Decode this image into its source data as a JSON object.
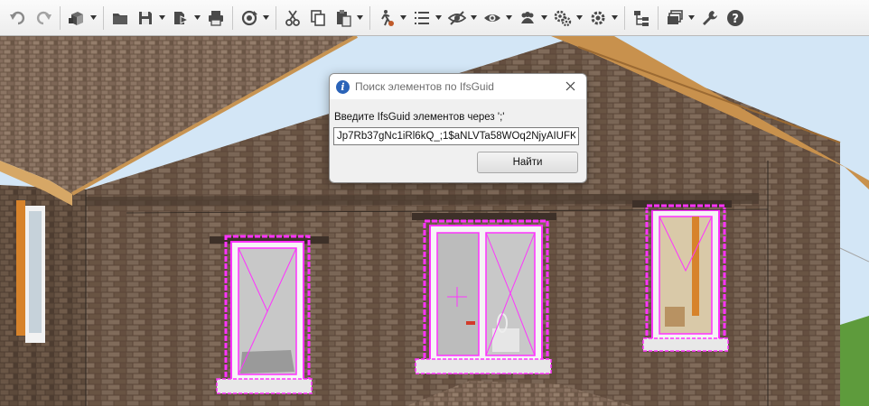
{
  "toolbar": {
    "buttons": [
      {
        "icon": "undo-icon",
        "dropdown": false
      },
      {
        "icon": "redo-icon",
        "dropdown": false
      },
      {
        "icon": "model-3d-icon",
        "dropdown": true
      },
      {
        "icon": "open-folder-icon",
        "dropdown": false
      },
      {
        "icon": "save-icon",
        "dropdown": true
      },
      {
        "icon": "export-icon",
        "dropdown": true
      },
      {
        "icon": "print-icon",
        "dropdown": false
      },
      {
        "icon": "orbit-icon",
        "dropdown": true
      },
      {
        "icon": "cut-icon",
        "dropdown": false
      },
      {
        "icon": "copy-icon",
        "dropdown": false
      },
      {
        "icon": "paste-icon",
        "dropdown": true
      },
      {
        "icon": "walk-icon",
        "dropdown": true
      },
      {
        "icon": "list-icon",
        "dropdown": true
      },
      {
        "icon": "hide-icon",
        "dropdown": true
      },
      {
        "icon": "show-icon",
        "dropdown": true
      },
      {
        "icon": "people-icon",
        "dropdown": true
      },
      {
        "icon": "gears-icon",
        "dropdown": true
      },
      {
        "icon": "settings-icon",
        "dropdown": true
      },
      {
        "icon": "tree-icon",
        "dropdown": false
      },
      {
        "icon": "layers-icon",
        "dropdown": true
      },
      {
        "icon": "wrench-icon",
        "dropdown": false
      },
      {
        "icon": "help-icon",
        "dropdown": false
      }
    ]
  },
  "dialog": {
    "title": "Поиск элементов по IfsGuid",
    "prompt": "Введите IfsGuid элементов через ';'",
    "guid_value": "Jp7Rb37gNc1iRl6kQ_;1$aNLVTa58WOq2NjyAIUFK",
    "find_button": "Найти"
  },
  "colors": {
    "selection": "#ff33ff",
    "brick": "#5e4a3d",
    "sky": "#cfe3f4",
    "dialog_icon": "#2a63b8"
  }
}
